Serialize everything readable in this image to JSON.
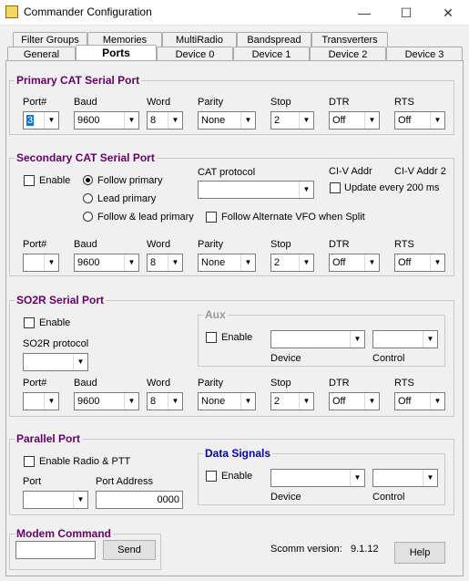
{
  "window": {
    "title": "Commander Configuration",
    "minimize": "—",
    "maximize": "☐",
    "close": "✕"
  },
  "tabs_row1": [
    "Filter Groups",
    "Memories",
    "MultiRadio",
    "Bandspread",
    "Transverters"
  ],
  "tabs_row2": [
    "General",
    "Ports",
    "Device 0",
    "Device 1",
    "Device 2",
    "Device 3"
  ],
  "active_tab": "Ports",
  "headers": {
    "port": "Port#",
    "baud": "Baud",
    "word": "Word",
    "parity": "Parity",
    "stop": "Stop",
    "dtr": "DTR",
    "rts": "RTS"
  },
  "primary": {
    "title": "Primary CAT Serial Port",
    "port": "3",
    "baud": "9600",
    "word": "8",
    "parity": "None",
    "stop": "2",
    "dtr": "Off",
    "rts": "Off"
  },
  "secondary": {
    "title": "Secondary CAT Serial Port",
    "enable": "Enable",
    "follow_primary": "Follow primary",
    "lead_primary": "Lead primary",
    "follow_lead": "Follow & lead primary",
    "cat_protocol": "CAT protocol",
    "civ1": "CI-V Addr",
    "civ2": "CI-V Addr 2",
    "update": "Update every 200 ms",
    "follow_alt": "Follow Alternate VFO when Split",
    "port": "",
    "baud": "9600",
    "word": "8",
    "parity": "None",
    "stop": "2",
    "dtr": "Off",
    "rts": "Off"
  },
  "so2r": {
    "title": "SO2R Serial Port",
    "enable": "Enable",
    "protocol": "SO2R protocol",
    "aux": "Aux",
    "aux_enable": "Enable",
    "device": "Device",
    "control": "Control",
    "port": "",
    "baud": "9600",
    "word": "8",
    "parity": "None",
    "stop": "2",
    "dtr": "Off",
    "rts": "Off"
  },
  "parallel": {
    "title": "Parallel Port",
    "enable": "Enable Radio & PTT",
    "port": "Port",
    "address_label": "Port Address",
    "address_value": "0000",
    "data_signals": "Data Signals",
    "ds_enable": "Enable",
    "device": "Device",
    "control": "Control"
  },
  "modem": {
    "title": "Modem Command",
    "send": "Send"
  },
  "version": {
    "label": "Scomm version:",
    "value": "9.1.12"
  },
  "help": "Help"
}
